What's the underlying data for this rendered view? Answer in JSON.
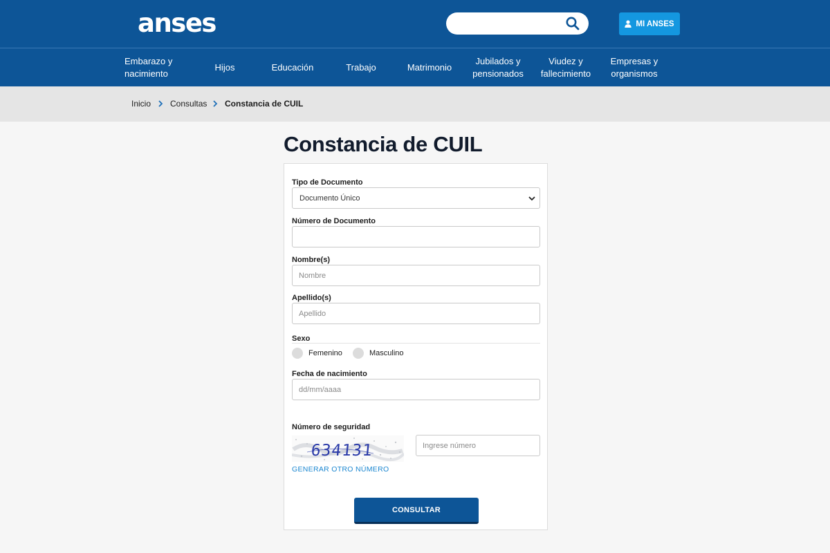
{
  "header": {
    "logo": "anses",
    "search": {
      "value": "",
      "placeholder": ""
    },
    "login_label": "MI ANSES",
    "colors": {
      "primary": "#0d5597",
      "accent": "#1497e0"
    }
  },
  "nav": {
    "items": [
      {
        "label": "Embarazo y\nnacimiento"
      },
      {
        "label": "Hijos"
      },
      {
        "label": "Educación"
      },
      {
        "label": "Trabajo"
      },
      {
        "label": "Matrimonio"
      },
      {
        "label": "Jubilados y\npensionados"
      },
      {
        "label": "Viudez y\nfallecimiento"
      },
      {
        "label": "Empresas y\norganismos"
      }
    ]
  },
  "breadcrumb": {
    "items": [
      "Inicio",
      "Consultas",
      "Constancia de CUIL"
    ]
  },
  "page": {
    "title": "Constancia de CUIL"
  },
  "form": {
    "tipo_documento": {
      "label": "Tipo de Documento",
      "value": "Documento Único"
    },
    "numero_documento": {
      "label": "Número de Documento",
      "value": "",
      "placeholder": ""
    },
    "nombre": {
      "label": "Nombre(s)",
      "value": "",
      "placeholder": "Nombre"
    },
    "apellido": {
      "label": "Apellido(s)",
      "value": "",
      "placeholder": "Apellido"
    },
    "sexo": {
      "label": "Sexo",
      "options": [
        "Femenino",
        "Masculino"
      ]
    },
    "fecha_nacimiento": {
      "label": "Fecha de nacimiento",
      "value": "",
      "placeholder": "dd/mm/aaaa"
    },
    "seguridad": {
      "label": "Número de seguridad",
      "captcha_text": "634131",
      "input_placeholder": "Ingrese número",
      "regenerate_label": "GENERAR OTRO NÚMERO"
    },
    "submit_label": "CONSULTAR"
  }
}
